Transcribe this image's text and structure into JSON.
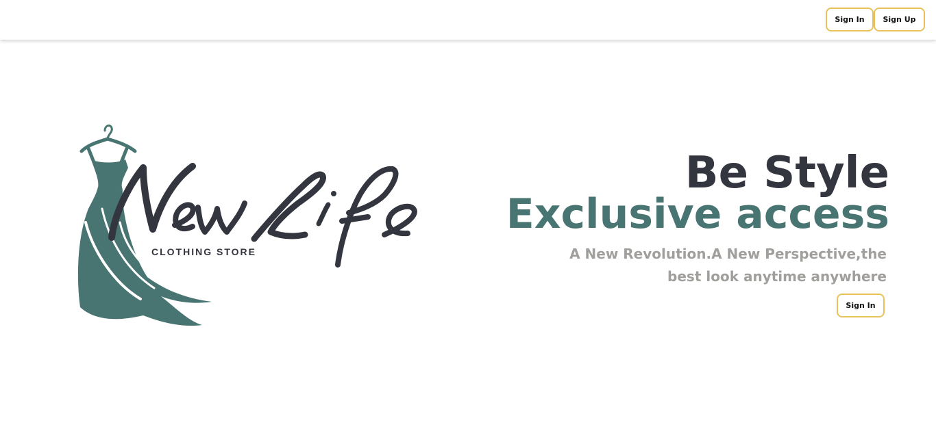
{
  "header": {
    "sign_in_label": "Sign In",
    "sign_up_label": "Sign Up"
  },
  "logo": {
    "wordmark": "NewLife",
    "tagline": "CLOTHING STORE",
    "icon": "dress-on-hanger-icon"
  },
  "hero": {
    "title": "Be Style",
    "highlight": "Exclusive access",
    "subtitle": "A New Revolution.A New Perspective,the best look anytime anywhere",
    "sign_in_label": "Sign In"
  },
  "colors": {
    "dark": "#34363f",
    "brand_teal": "#487472",
    "muted_text": "#a19f9c",
    "button_border": "#e8c15a"
  }
}
